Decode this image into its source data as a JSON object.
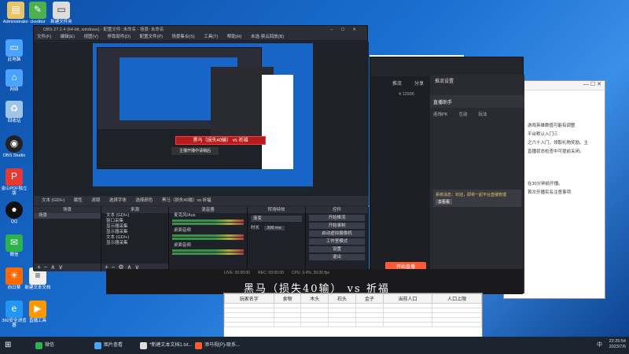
{
  "desktop": {
    "icons": [
      {
        "label": "Administrator",
        "icon": "user-folder-icon"
      },
      {
        "label": "ckeditor",
        "icon": "ckeditor-icon"
      },
      {
        "label": "新建文件夹",
        "icon": "pc-icon"
      },
      {
        "label": "此电脑",
        "icon": "computer-icon"
      },
      {
        "label": "网络",
        "icon": "network-icon"
      },
      {
        "label": "回收站",
        "icon": "recycle-bin-icon"
      },
      {
        "label": "OBS Studio",
        "icon": "obs-icon"
      },
      {
        "label": "金山PDF独立版",
        "icon": "pdf-icon"
      },
      {
        "label": "QQ",
        "icon": "qq-icon"
      },
      {
        "label": "微信",
        "icon": "wechat-icon"
      },
      {
        "label": "向日葵",
        "icon": "sunlogin-icon"
      },
      {
        "label": "新建文本文档",
        "icon": "text-doc-icon"
      },
      {
        "label": "360安全浏览器",
        "icon": "browser-icon"
      },
      {
        "label": "直播工具",
        "icon": "live-tool-icon"
      }
    ]
  },
  "obs": {
    "title": "OBS 27.2.4 (64-bit, windows) - 配置文件: 未命名 - 场景: 未命名",
    "menu": [
      "文件(F)",
      "编辑(E)",
      "视图(V)",
      "停靠部件(D)",
      "配置文件(P)",
      "场景集合(S)",
      "工具(T)",
      "帮助(H)",
      "未选·费云回放(B)"
    ],
    "source_bar": [
      "文本 (GDI+)",
      "属性",
      "滤镜",
      "选择字体",
      "选择颜色",
      "黑马（损失40输）vs 祈福"
    ],
    "overlay_text": "黑马（损失40输） vs 祈福",
    "overlay_sub": "主播开播中请稍后",
    "docks": {
      "scenes": {
        "header": "场景",
        "items": [
          "场景"
        ]
      },
      "sources": {
        "header": "来源",
        "items": [
          "文本 (GDI+)",
          "窗口采集",
          "显示器采集",
          "显示器采集",
          "文本 (GDI+)",
          "显示器采集"
        ]
      },
      "mixer": {
        "header": "混音器",
        "channels": [
          "麦克风/Aux",
          "桌面音频",
          "桌面音频"
        ]
      },
      "transitions": {
        "header": "转场特效",
        "type": "渐变",
        "duration_label": "时长",
        "duration": "300 ms"
      },
      "controls": {
        "header": "控件",
        "buttons": [
          "开始推流",
          "开始录制",
          "启动虚拟摄像机",
          "工作室模式",
          "设置",
          "退出"
        ]
      }
    },
    "status": {
      "live": "LIVE: 00:00:00",
      "rec": "REC: 00:00:00",
      "cpu": "CPU: 3.4%, 30.00 fps"
    }
  },
  "live_app": {
    "title": "直播伴侣",
    "tabs": [
      "推流",
      "分享"
    ],
    "stats": "4  12936",
    "panel_title": "推流设置",
    "panel_tabs": [
      "直播助手",
      "连线PK",
      "互动",
      "玩法"
    ],
    "start_button": "开始直播",
    "announcement": "系统消息：欢迎，即将一起平台直播管理",
    "announce_btn": "去看看"
  },
  "doc_window": {
    "text_snippets": [
      "游戏英雄数值可能有调整",
      "平台默认入门三",
      "之六十入门，领取礼物奖励。主",
      "直播状态检查中可提前关闭。",
      "在30分钟前开播。",
      "首次开播实名注意事项"
    ]
  },
  "sheet": {
    "headers": [
      "玩家名字",
      "食物",
      "木头",
      "石头",
      "金子",
      "当前人口",
      "人口上限"
    ]
  },
  "caption": "黑马（损失40输） vs  祈福",
  "taskbar": {
    "items": [
      "微信",
      "图片查看",
      "*新建文本文档1.txt...",
      "添马视(P)-联系..."
    ],
    "clock_time": "22:25:54",
    "clock_date": "2023/7/6",
    "lang": "中"
  }
}
